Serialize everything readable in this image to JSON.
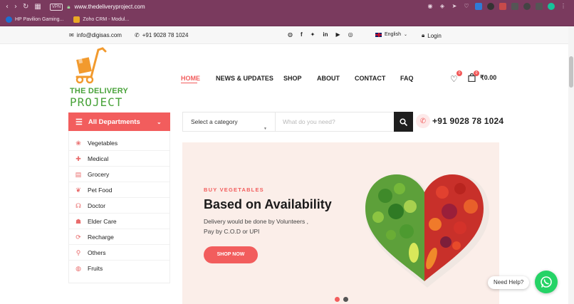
{
  "browser": {
    "url": "www.thedeliveryproject.com",
    "vpn_label": "VPN",
    "bookmarks": [
      {
        "label": "HP Pavilion Gaming..."
      },
      {
        "label": "Zoho CRM - Modul..."
      }
    ]
  },
  "topbar": {
    "email": "info@digisas.com",
    "phone": "+91 9028 78 1024",
    "language": "English",
    "login": "Login"
  },
  "logo": {
    "line1": "THE DELIVERY",
    "line2": "PROJECT"
  },
  "nav": {
    "items": [
      "HOME",
      "NEWS & UPDATES",
      "SHOP",
      "ABOUT",
      "CONTACT",
      "FAQ"
    ],
    "active": "HOME"
  },
  "header": {
    "wishlist_count": "0",
    "cart_count": "0",
    "cart_total": "₹0.00"
  },
  "departments": {
    "title": "All Departments",
    "items": [
      "Vegetables",
      "Medical",
      "Grocery",
      "Pet Food",
      "Doctor",
      "Elder Care",
      "Recharge",
      "Others",
      "Fruits"
    ]
  },
  "search": {
    "category": "Select a category",
    "placeholder": "What do you need?"
  },
  "contact": {
    "phone": "+91 9028 78 1024"
  },
  "hero": {
    "subtitle": "BUY VEGETABLES",
    "title": "Based on Availability",
    "description": "Delivery would be done by Volunteers , Pay by C.O.D or UPI",
    "button": "SHOP NOW"
  },
  "help": {
    "label": "Need Help?"
  },
  "colors": {
    "accent": "#f25d5d",
    "brand_green": "#4aa33b",
    "browser_chrome": "#7a3a5e",
    "whatsapp": "#25d366"
  }
}
